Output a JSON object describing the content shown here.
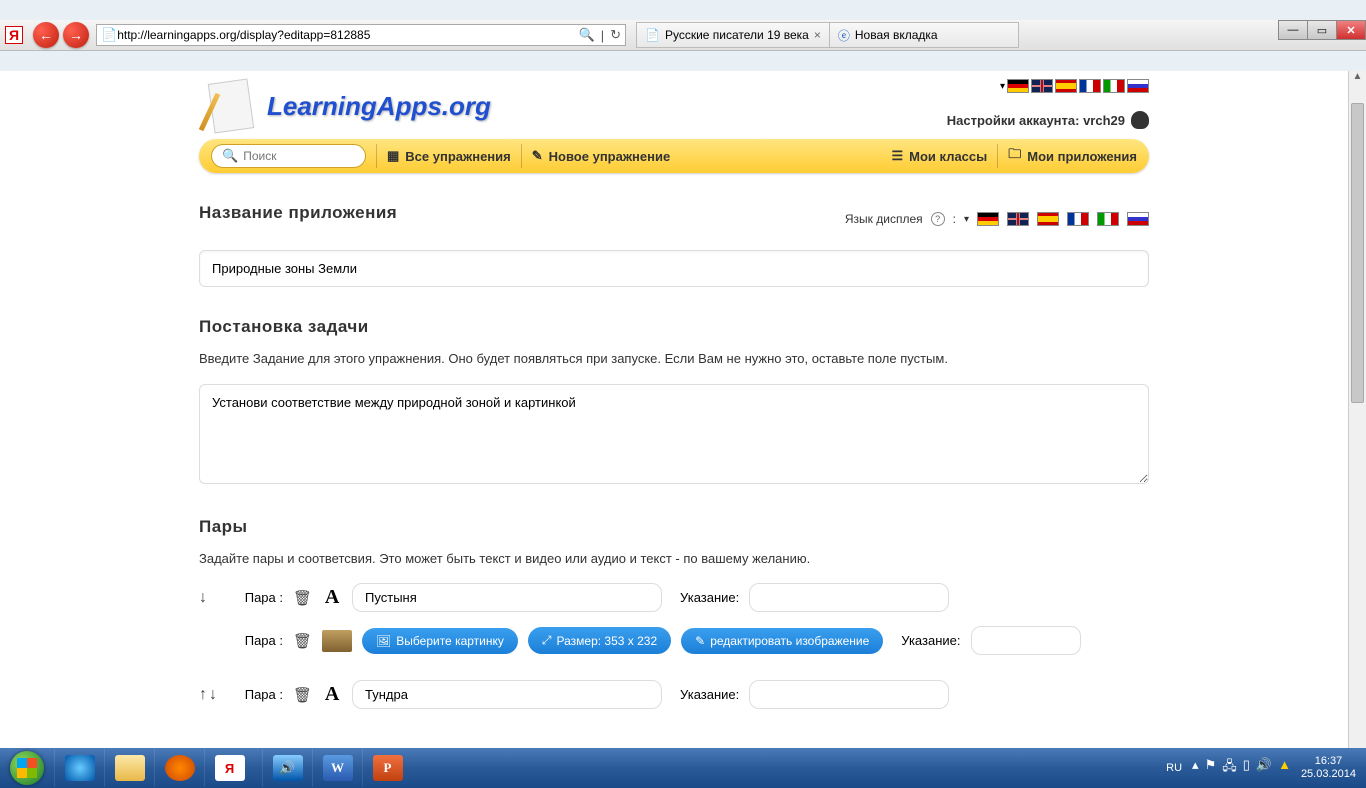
{
  "window": {
    "min": "—",
    "max": "▭",
    "close": "✕"
  },
  "browser": {
    "back": "←",
    "forward": "→",
    "url": "http://learningapps.org/display?editapp=812885",
    "search": "🔍",
    "refresh": "↻",
    "tab1": "Русские писатели 19 века",
    "tab2": "Новая вкладка",
    "star": "☆",
    "gear": "⚙"
  },
  "header": {
    "logo": "LearningApps.org",
    "account": "Настройки аккаунта: vrch29"
  },
  "nav": {
    "search_placeholder": "Поиск",
    "all": "Все упражнения",
    "new": "Новое упражнение",
    "classes": "Мои классы",
    "apps": "Мои приложения"
  },
  "section_title": {
    "heading": "Название приложения",
    "display_lang": "Язык дисплея",
    "value": "Природные зоны Земли"
  },
  "section_task": {
    "heading": "Постановка задачи",
    "desc": "Введите Задание для этого упражнения. Оно будет появляться при запуске. Если Вам не нужно это, оставьте поле пустым.",
    "value": "Установи соответствие между природной зоной и картинкой"
  },
  "section_pairs": {
    "heading": "Пары",
    "desc": "Задайте пары и соответсвия. Это может быть текст и видео или аудио и текст - по вашему желанию.",
    "pair_label": "Пара :",
    "hint_label": "Указание:",
    "pair1_text": "Пустыня",
    "btn_select_img": "Выберите картинку",
    "btn_size": "Размер: 353 x 232",
    "btn_edit": "редактировать изображение",
    "pair2_text": "Тундра"
  },
  "taskbar": {
    "lang": "RU",
    "time": "16:37",
    "date": "25.03.2014"
  }
}
